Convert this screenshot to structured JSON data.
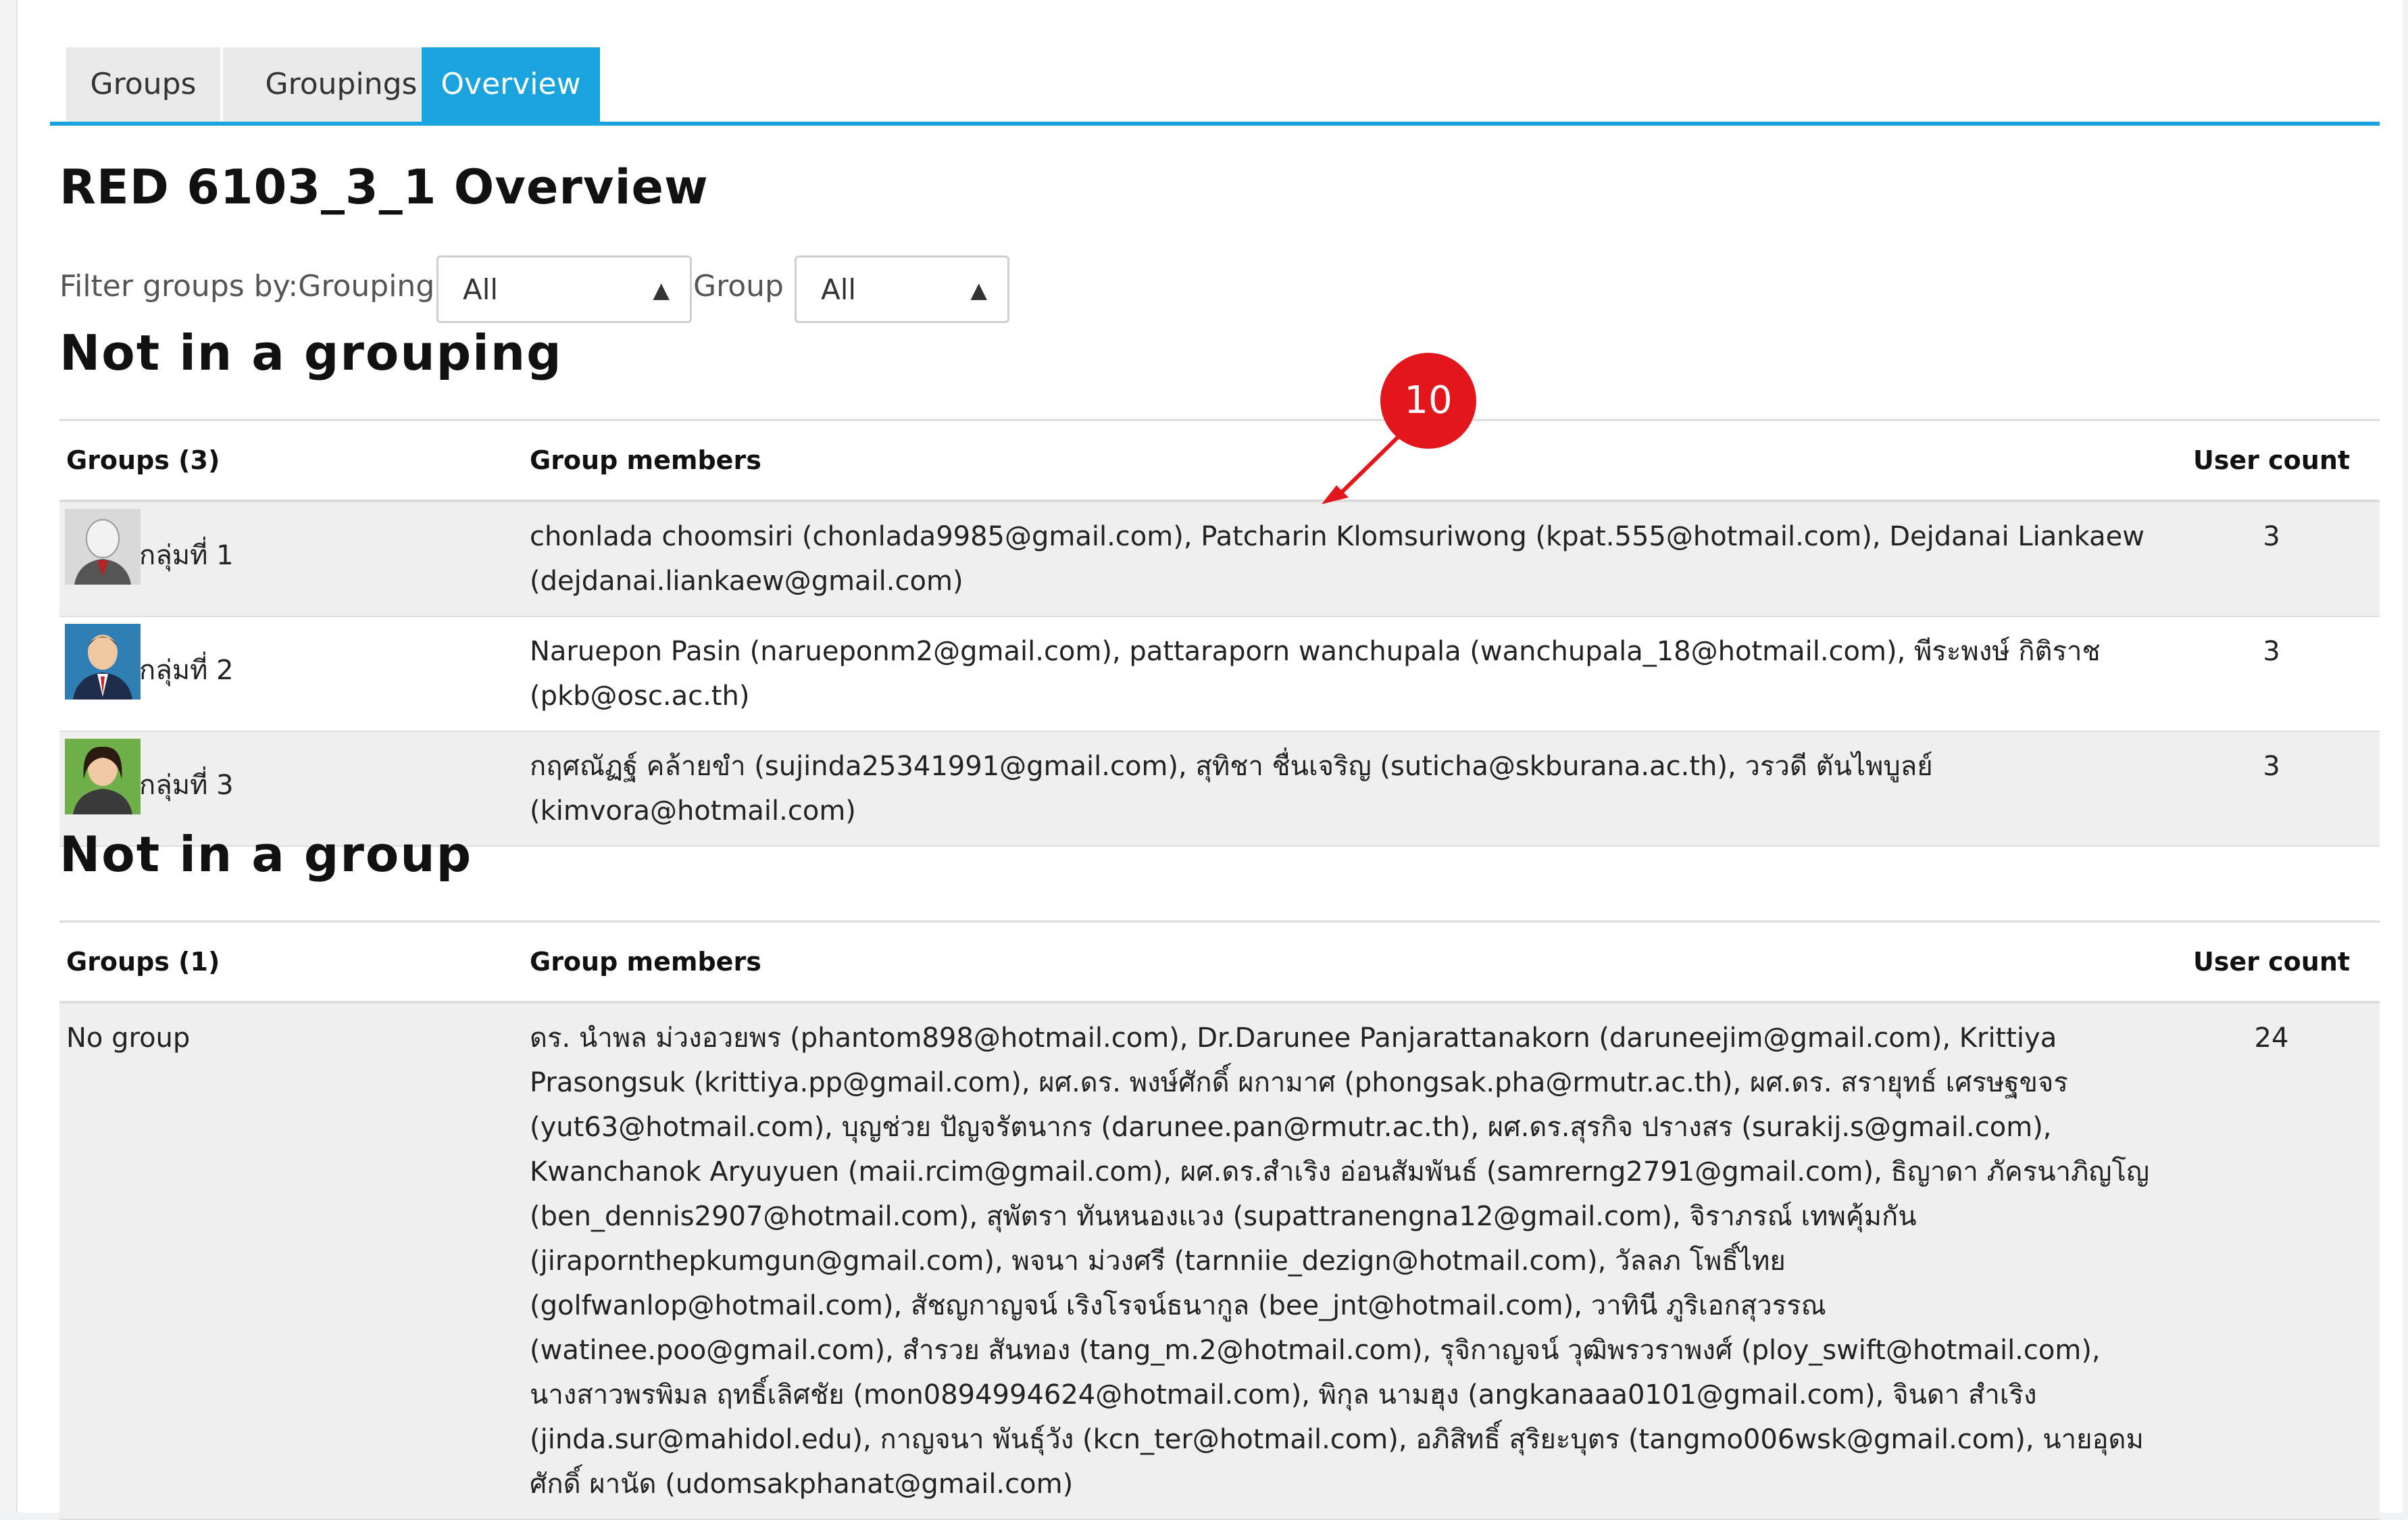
{
  "tabs": [
    {
      "label": "Groups"
    },
    {
      "label": "Groupings"
    },
    {
      "label": "Overview"
    }
  ],
  "page_title": "RED 6103_3_1 Overview",
  "filter": {
    "label": "Filter groups by:Grouping",
    "grouping_value": "All",
    "group_label": "Group",
    "group_value": "All"
  },
  "section_not_in_grouping": {
    "title": "Not in a grouping",
    "headers": {
      "groups": "Groups (3)",
      "members": "Group members",
      "count": "User count"
    },
    "rows": [
      {
        "name": "กลุ่มที่ 1",
        "members": "chonlada choomsiri (chonlada9985@gmail.com), Patcharin Klomsuriwong (kpat.555@hotmail.com), Dejdanai Liankaew (dejdanai.liankaew@gmail.com)",
        "count": "3"
      },
      {
        "name": "กลุ่มที่ 2",
        "members": "Naruepon Pasin (narueponm2@gmail.com), pattaraporn wanchupala (wanchupala_18@hotmail.com), พีระพงษ์ กิติราช (pkb@osc.ac.th)",
        "count": "3"
      },
      {
        "name": "กลุ่มที่ 3",
        "members": "กฤศณัฏฐ์ คล้ายขำ (sujinda25341991@gmail.com), สุทิชา ชื่นเจริญ (suticha@skburana.ac.th), วรวดี ตันไพบูลย์ (kimvora@hotmail.com)",
        "count": "3"
      }
    ]
  },
  "section_not_in_group": {
    "title": "Not in a group",
    "headers": {
      "groups": "Groups (1)",
      "members": "Group members",
      "count": "User count"
    },
    "rows": [
      {
        "name": "No group",
        "members": "ดร. นำพล ม่วงอวยพร (phantom898@hotmail.com), Dr.Darunee Panjarattanakorn (daruneejim@gmail.com), Krittiya Prasongsuk (krittiya.pp@gmail.com), ผศ.ดร. พงษ์ศักดิ์ ผกามาศ (phongsak.pha@rmutr.ac.th), ผศ.ดร. สรายุทธ์ เศรษฐขจร (yut63@hotmail.com), บุญช่วย ปัญจรัตนากร (darunee.pan@rmutr.ac.th), ผศ.ดร.สุรกิจ ปรางสร (surakij.s@gmail.com), Kwanchanok Aryuyuen (maii.rcim@gmail.com), ผศ.ดร.สำเริง อ่อนสัมพันธ์ (samrerng2791@gmail.com), ธิญาดา ภัครนาภิญโญ (ben_dennis2907@hotmail.com), สุพัตรา ทันหนองแวง (supattranengna12@gmail.com), จิราภรณ์ เทพคุ้มกัน (jirapornthepkumgun@gmail.com), พจนา ม่วงศรี (tarnniie_dezign@hotmail.com), วัลลภ โพธิ์ไทย (golfwanlop@hotmail.com), สัชญกาญจน์ เริงโรจน์ธนากูล (bee_jnt@hotmail.com), วาทินี ภูริเอกสุวรรณ (watinee.poo@gmail.com), สำรวย สันทอง (tang_m.2@hotmail.com), รุจิกาญจน์ วุฒิพรวราพงศ์ (ploy_swift@hotmail.com), นางสาวพรพิมล ฤทธิ์เลิศชัย (mon0894994624@hotmail.com), พิกุล นามฮุง (angkanaaa0101@gmail.com), จินดา สำเริง (jinda.sur@mahidol.edu), กาญจนา พันธุ์วัง (kcn_ter@hotmail.com), อภิสิทธิ์ สุริยะบุตร (tangmo006wsk@gmail.com), นายอุดมศักดิ์ ผานัด (udomsakphanat@gmail.com)",
        "count": "24"
      }
    ]
  },
  "callout": {
    "label": "10",
    "color": "#e3161b"
  },
  "colors": {
    "accent": "#1aa3dc"
  },
  "icons": [
    "chevron-updown-icon",
    "user-avatar-icon",
    "arrow-pointer-icon"
  ]
}
